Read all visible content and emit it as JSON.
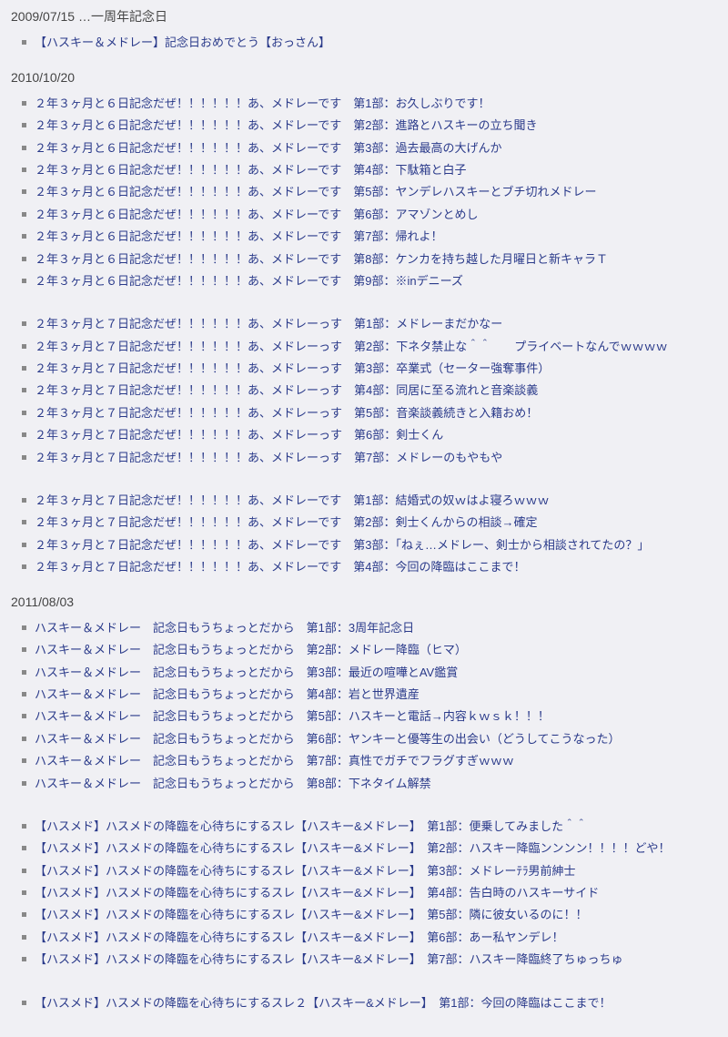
{
  "sections": [
    {
      "heading": "2009/07/15 …一周年記念日",
      "groups": [
        {
          "items": [
            "【ハスキー＆メドレー】記念日おめでとう【おっさん】"
          ]
        }
      ]
    },
    {
      "heading": "2010/10/20",
      "groups": [
        {
          "items": [
            "２年３ヶ月と６日記念だぜ！！！！！！あ、メドレーです　第1部：お久しぶりです！",
            "２年３ヶ月と６日記念だぜ！！！！！！あ、メドレーです　第2部：進路とハスキーの立ち聞き",
            "２年３ヶ月と６日記念だぜ！！！！！！あ、メドレーです　第3部：過去最高の大げんか",
            "２年３ヶ月と６日記念だぜ！！！！！！あ、メドレーです　第4部：下駄箱と白子",
            "２年３ヶ月と６日記念だぜ！！！！！！あ、メドレーです　第5部：ヤンデレハスキーとブチ切れメドレー",
            "２年３ヶ月と６日記念だぜ！！！！！！あ、メドレーです　第6部：アマゾンとめし",
            "２年３ヶ月と６日記念だぜ！！！！！！あ、メドレーです　第7部：帰れよ！",
            "２年３ヶ月と６日記念だぜ！！！！！！あ、メドレーです　第8部：ケンカを持ち越した月曜日と新キャラＴ",
            "２年３ヶ月と６日記念だぜ！！！！！！あ、メドレーです　第9部：※inデニーズ"
          ]
        },
        {
          "items": [
            "２年３ヶ月と７日記念だぜ！！！！！！あ、メドレーっす　第1部：メドレーまだかなー",
            "２年３ヶ月と７日記念だぜ！！！！！！あ、メドレーっす　第2部：下ネタ禁止な＾＾　　プライベートなんでｗｗｗｗ",
            "２年３ヶ月と７日記念だぜ！！！！！！あ、メドレーっす　第3部：卒業式（セーター強奪事件）",
            "２年３ヶ月と７日記念だぜ！！！！！！あ、メドレーっす　第4部：同居に至る流れと音楽談義",
            "２年３ヶ月と７日記念だぜ！！！！！！あ、メドレーっす　第5部：音楽談義続きと入籍おめ！",
            "２年３ヶ月と７日記念だぜ！！！！！！あ、メドレーっす　第6部：剣士くん",
            "２年３ヶ月と７日記念だぜ！！！！！！あ、メドレーっす　第7部：メドレーのもやもや"
          ]
        },
        {
          "items": [
            "２年３ヶ月と７日記念だぜ！！！！！！あ、メドレーです　第1部：結婚式の奴ｗはよ寝ろｗｗｗ",
            "２年３ヶ月と７日記念だぜ！！！！！！あ、メドレーです　第2部：剣士くんからの相談→確定",
            "２年３ヶ月と７日記念だぜ！！！！！！あ、メドレーです　第3部：「ねぇ…メドレー、剣士から相談されてたの？」",
            "２年３ヶ月と７日記念だぜ！！！！！！あ、メドレーです　第4部：今回の降臨はここまで！"
          ]
        }
      ]
    },
    {
      "heading": "2011/08/03",
      "groups": [
        {
          "items": [
            "ハスキー＆メドレー　記念日もうちょっとだから　第1部：3周年記念日",
            "ハスキー＆メドレー　記念日もうちょっとだから　第2部：メドレー降臨（ヒマ）",
            "ハスキー＆メドレー　記念日もうちょっとだから　第3部：最近の喧嘩とAV鑑賞",
            "ハスキー＆メドレー　記念日もうちょっとだから　第4部：岩と世界遺産",
            "ハスキー＆メドレー　記念日もうちょっとだから　第5部：ハスキーと電話→内容ｋｗｓｋ！！！",
            "ハスキー＆メドレー　記念日もうちょっとだから　第6部：ヤンキーと優等生の出会い（どうしてこうなった）",
            "ハスキー＆メドレー　記念日もうちょっとだから　第7部：真性でガチでフラグすぎｗｗｗ",
            "ハスキー＆メドレー　記念日もうちょっとだから　第8部：下ネタイム解禁"
          ]
        },
        {
          "items": [
            "【ハスメド】ハスメドの降臨を心待ちにするスレ【ハスキー&メドレー】　第1部：便乗してみました＾＾",
            "【ハスメド】ハスメドの降臨を心待ちにするスレ【ハスキー&メドレー】　第2部：ハスキー降臨ンンンン！！！！どや！",
            "【ハスメド】ハスメドの降臨を心待ちにするスレ【ハスキー&メドレー】　第3部：メドレーﾃﾗ男前紳士",
            "【ハスメド】ハスメドの降臨を心待ちにするスレ【ハスキー&メドレー】　第4部：告白時のハスキーサイド",
            "【ハスメド】ハスメドの降臨を心待ちにするスレ【ハスキー&メドレー】　第5部：隣に彼女いるのに！！",
            "【ハスメド】ハスメドの降臨を心待ちにするスレ【ハスキー&メドレー】　第6部：あー私ヤンデレ！",
            "【ハスメド】ハスメドの降臨を心待ちにするスレ【ハスキー&メドレー】　第7部：ハスキー降臨終了ちゅっちゅ"
          ]
        },
        {
          "items": [
            "【ハスメド】ハスメドの降臨を心待ちにするスレ２【ハスキー&メドレー】　第1部：今回の降臨はここまで！"
          ]
        }
      ]
    }
  ]
}
